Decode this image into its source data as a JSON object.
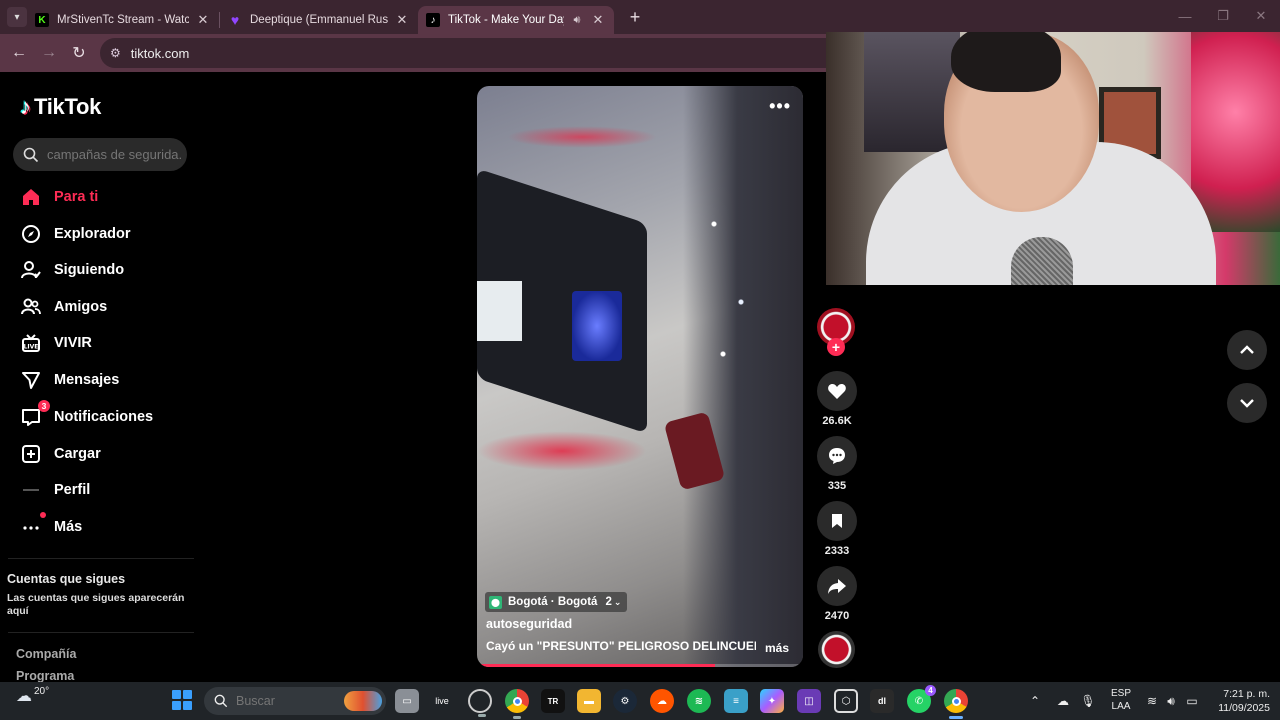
{
  "browser": {
    "tabs": [
      {
        "title": "MrStivenTc Stream - Watch Live",
        "favicon": "K",
        "favicon_color": "#53fc18"
      },
      {
        "title": "Deeptique (Emmanuel Russ Rey",
        "favicon": "♥",
        "favicon_color": "#9146ff"
      },
      {
        "title": "TikTok - Make Your Day",
        "favicon": "♪",
        "favicon_color": "#ffffff"
      }
    ],
    "url": "tiktok.com"
  },
  "tiktok": {
    "logo_text": "TikTok",
    "search_placeholder": "campañas de segurida...",
    "nav": [
      {
        "label": "Para ti"
      },
      {
        "label": "Explorador"
      },
      {
        "label": "Siguiendo"
      },
      {
        "label": "Amigos"
      },
      {
        "label": "VIVIR"
      },
      {
        "label": "Mensajes"
      },
      {
        "label": "Notificaciones",
        "badge": "3"
      },
      {
        "label": "Cargar"
      },
      {
        "label": "Perfil"
      },
      {
        "label": "Más"
      }
    ],
    "following_heading": "Cuentas que sigues",
    "following_sub": "Las cuentas que sigues aparecerán aquí",
    "footer_links": [
      "Compañía",
      "Programa"
    ]
  },
  "video": {
    "location": "Bogotá · Bogotá",
    "location_count": "2",
    "author": "autoseguridad",
    "caption": "Cayó un \"PRESUNTO\" PELIGROSO DELINCUENTE...",
    "more_label": "más",
    "progress": 0.73,
    "likes": "26.6K",
    "comments": "335",
    "saves": "2333",
    "shares": "2470"
  },
  "taskbar": {
    "temperature": "20°",
    "search_placeholder": "Buscar",
    "live_label": "live",
    "tr_label": "TR",
    "whatsapp_badge": "4",
    "language_top": "ESP",
    "language_bottom": "LAA",
    "time": "7:21 p. m.",
    "date": "11/09/2025"
  },
  "colors": {
    "accent": "#fe2c55",
    "browser_frame": "#3b2530",
    "browser_toolbar": "#5a3646"
  }
}
